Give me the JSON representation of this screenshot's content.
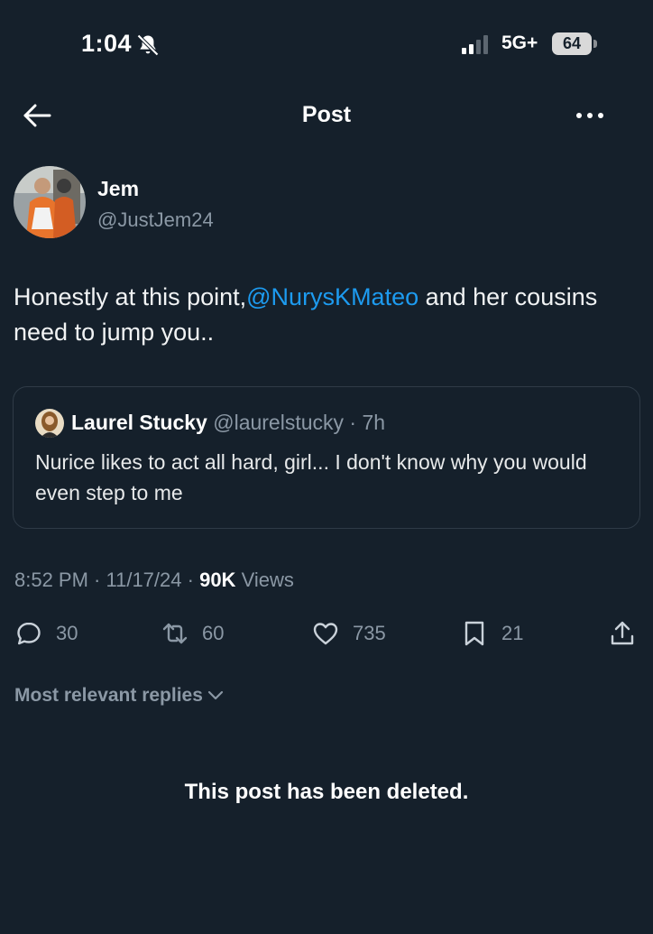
{
  "status_bar": {
    "time": "1:04",
    "network": "5G+",
    "battery": "64"
  },
  "header": {
    "title": "Post"
  },
  "post": {
    "author_name": "Jem",
    "author_handle": "@JustJem24",
    "text_before": "Honestly at this point,",
    "mention": "@NurysKMateo",
    "text_after": " and her cousins need to jump you..",
    "meta": {
      "time": "8:52 PM",
      "date": "11/17/24",
      "views_count": "90K",
      "views_label": "Views"
    }
  },
  "quote": {
    "name": "Laurel Stucky",
    "handle": "@laurelstucky",
    "time": "7h",
    "text": "Nurice likes to act all hard, girl... I don't know why you would even step to me"
  },
  "actions": {
    "replies": "30",
    "reposts": "60",
    "likes": "735",
    "bookmarks": "21"
  },
  "replies_sort": "Most relevant replies",
  "deleted_message": "This post has been deleted.",
  "colors": {
    "background": "#15202b",
    "accent": "#1d9bf0",
    "secondary_text": "#8b98a5"
  }
}
